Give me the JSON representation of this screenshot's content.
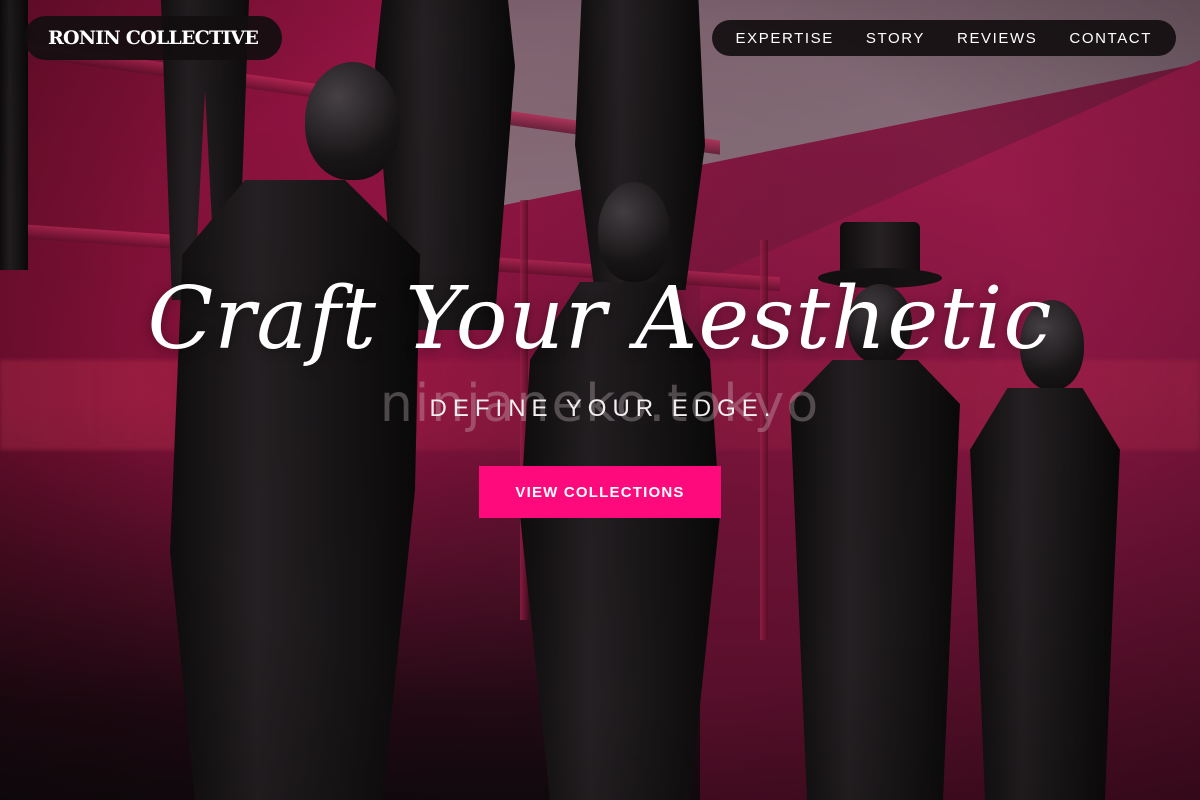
{
  "brand": {
    "name": "RONIN COLLECTIVE"
  },
  "nav": {
    "items": [
      {
        "label": "EXPERTISE"
      },
      {
        "label": "STORY"
      },
      {
        "label": "REVIEWS"
      },
      {
        "label": "CONTACT"
      }
    ]
  },
  "hero": {
    "headline": "Craft Your Aesthetic",
    "subheadline": "DEFINE YOUR EDGE.",
    "watermark": "ninjaneko.tokyo",
    "cta_label": "VIEW COLLECTIONS"
  },
  "colors": {
    "accent": "#ff0a7c",
    "backdrop": "#a3164a",
    "nav_bg": "#120e10"
  }
}
